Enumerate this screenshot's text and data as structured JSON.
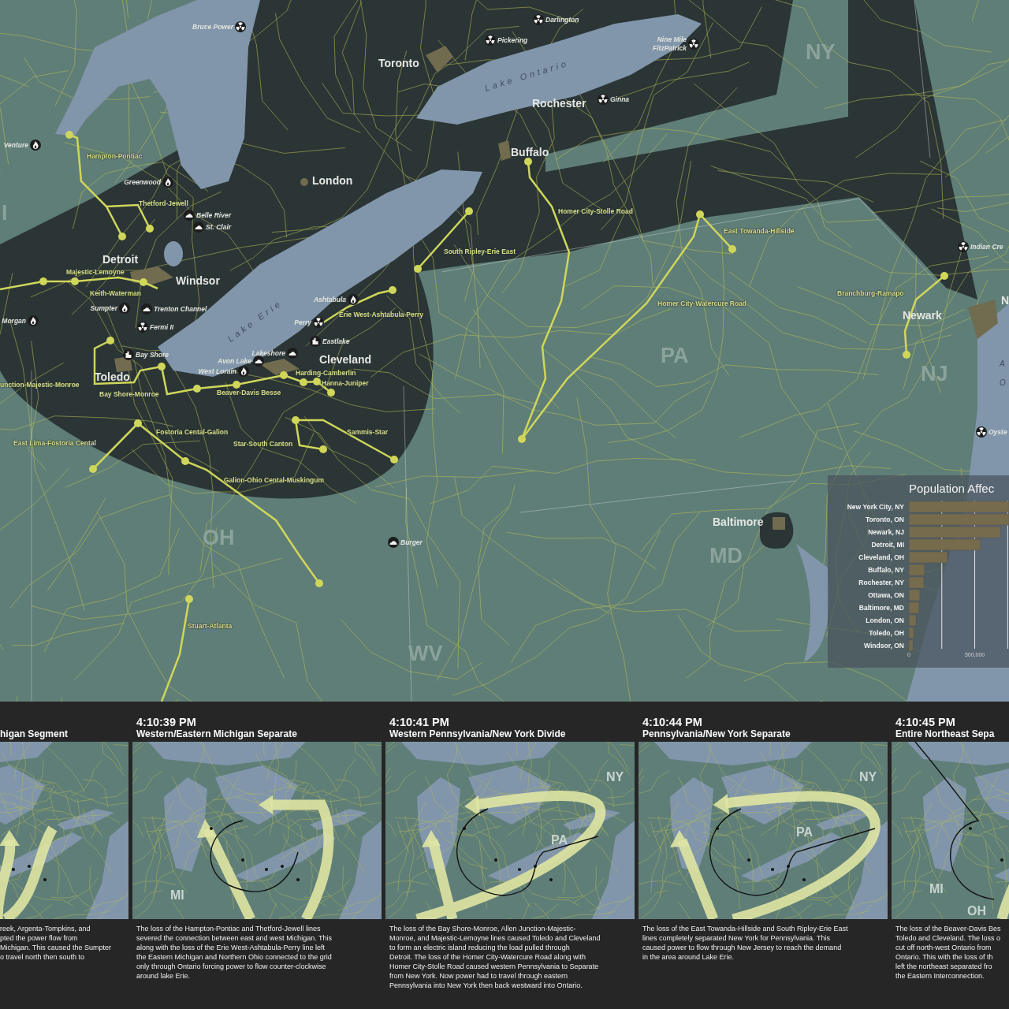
{
  "map": {
    "cities": [
      "Toronto",
      "Rochester",
      "Buffalo",
      "London",
      "Detroit",
      "Windsor",
      "Toledo",
      "Cleveland",
      "Newark",
      "Baltimore",
      "N"
    ],
    "plants": [
      {
        "names": [
          "Bruce Power"
        ],
        "kind": "nuclear"
      },
      {
        "names": [
          "Darlington"
        ],
        "kind": "nuclear"
      },
      {
        "names": [
          "Pickering"
        ],
        "kind": "nuclear"
      },
      {
        "names": [
          "Nine Mile",
          "FitzPatrick"
        ],
        "kind": "nuclear"
      },
      {
        "names": [
          "Ginna"
        ],
        "kind": "nuclear"
      },
      {
        "names": [
          "Venture"
        ],
        "kind": "gas"
      },
      {
        "names": [
          "Greenwood"
        ],
        "kind": "gas"
      },
      {
        "names": [
          "Belle River"
        ],
        "kind": "coal"
      },
      {
        "names": [
          "St. Clair"
        ],
        "kind": "coal"
      },
      {
        "names": [
          "Sumpter"
        ],
        "kind": "gas"
      },
      {
        "names": [
          "Trenton Channel"
        ],
        "kind": "coal"
      },
      {
        "names": [
          "Fermi II"
        ],
        "kind": "nuclear"
      },
      {
        "names": [
          "Morgan"
        ],
        "kind": "gas"
      },
      {
        "names": [
          "Bay Shore"
        ],
        "kind": "industrial"
      },
      {
        "names": [
          "Ashtabula"
        ],
        "kind": "gas"
      },
      {
        "names": [
          "Perry"
        ],
        "kind": "nuclear"
      },
      {
        "names": [
          "Eastlake"
        ],
        "kind": "industrial"
      },
      {
        "names": [
          "Lakeshore"
        ],
        "kind": "coal"
      },
      {
        "names": [
          "Avon Lake"
        ],
        "kind": "coal"
      },
      {
        "names": [
          "West Lorain"
        ],
        "kind": "gas"
      },
      {
        "names": [
          "Burger"
        ],
        "kind": "coal"
      },
      {
        "names": [
          "Indian Cre"
        ],
        "kind": "nuclear"
      },
      {
        "names": [
          "Oyste"
        ],
        "kind": "nuclear"
      }
    ],
    "line_labels": [
      "Hampton-Pontiac",
      "Thetford-Jewell",
      "Majestic-Lemoyne",
      "Keith-Waterman",
      "unction-Majestic-Monroe",
      "Bay Shore-Monroe",
      "Beaver-Davis Besse",
      "Harding-Camberlin",
      "Hanna-Juniper",
      "Fostoria Cental-Galion",
      "East Lima-Fostoria Cental",
      "Star-South Canton",
      "Sammis-Star",
      "Galion-Ohio Cental-Muskingum",
      "Stuart-Atlanta",
      "South Ripley-Erie East",
      "Erie West-Ashtabula-Perry",
      "Homer City-Stolle Road",
      "East Towanda-Hillside",
      "Homer City-Watercure Road",
      "Branchburg-Ramapo"
    ],
    "state_labels": [
      "NY",
      "PA",
      "NJ",
      "OH",
      "MD",
      "WV",
      "I"
    ],
    "water_labels": [
      "Lake Ontario",
      "Lake Erie",
      "A",
      "O"
    ]
  },
  "chart": {
    "chart_data": {
      "type": "bar",
      "orientation": "horizontal",
      "title": "Population Affec",
      "categories": [
        "New York City, NY",
        "Toronto, ON",
        "Newark, NJ",
        "Detroit, MI",
        "Cleveland, OH",
        "Buffalo, NY",
        "Rochester, NY",
        "Ottawa, ON",
        "Baltimore, MD",
        "London, ON",
        "Toledo, OH",
        "Windsor, ON"
      ],
      "series": [
        {
          "color": "#766b4c",
          "values": [
            760000,
            760000,
            696000,
            542000,
            292000,
            119000,
            113000,
            83000,
            77000,
            54000,
            36000,
            30000
          ]
        }
      ],
      "xlim": [
        0,
        760000
      ],
      "xticks": [
        0,
        {
          "value": 500000,
          "label": "500,000"
        }
      ]
    }
  },
  "timeline": [
    {
      "title": "higan Segment",
      "description": "reek, Argenta-Tompkins, and\npted the power flow from\nMichigan. This caused the Sumpter\no travel north then south to"
    },
    {
      "time": "4:10:39 PM",
      "title": "Western/Eastern Michigan Separate",
      "state_labels": [
        "MI"
      ],
      "description": "The loss of the Hampton-Pontiac and Thetford-Jewell lines\nsevered the connection between east and west Michigan. This\nalong with the loss of the Erie West-Ashtabula-Perry line left\nthe Eastern Michigan and Northern Ohio connected to the grid\nonly through Ontario forcing power to flow counter-clockwise\naround lake Erie."
    },
    {
      "time": "4:10:41 PM",
      "title": "Western Pennsylvania/New York Divide",
      "state_labels": [
        "NY",
        "PA"
      ],
      "description": "The loss of the Bay Shore-Monroe, Allen Junction-Majestic-\nMonroe, and Majestic-Lemoyne lines caused Toledo and Cleveland\nto form an electric island reducing the load pulled through\nDetroit. The loss of the Homer City-Watercure Road along with\nHomer City-Stolle Road caused western Pennsylvania to Separate\nfrom New York. Now power had to travel through eastern\nPennsylvania into New York then back westward into Ontario."
    },
    {
      "time": "4:10:44 PM",
      "title": "Pennsylvania/New York Separate",
      "state_labels": [
        "NY",
        "PA"
      ],
      "description": "The loss of the East Towanda-Hillside and South Ripley-Erie East\nlines completely separated New York for Pennsylvania. This\ncaused power to flow through New Jersey to reach the demand\nin the area around Lake Erie."
    },
    {
      "time": "4:10:45 PM",
      "title": "Entire Northeast Sepa",
      "state_labels": [
        "MI",
        "OH"
      ],
      "description": "The loss of the Beaver-Davis Bes\nToledo and Cleveland. The loss o\ncut off north-west Ontario from\nOntario. This with the loss of th\nleft the northeast separated fro\nthe Eastern Interconnection."
    }
  ]
}
